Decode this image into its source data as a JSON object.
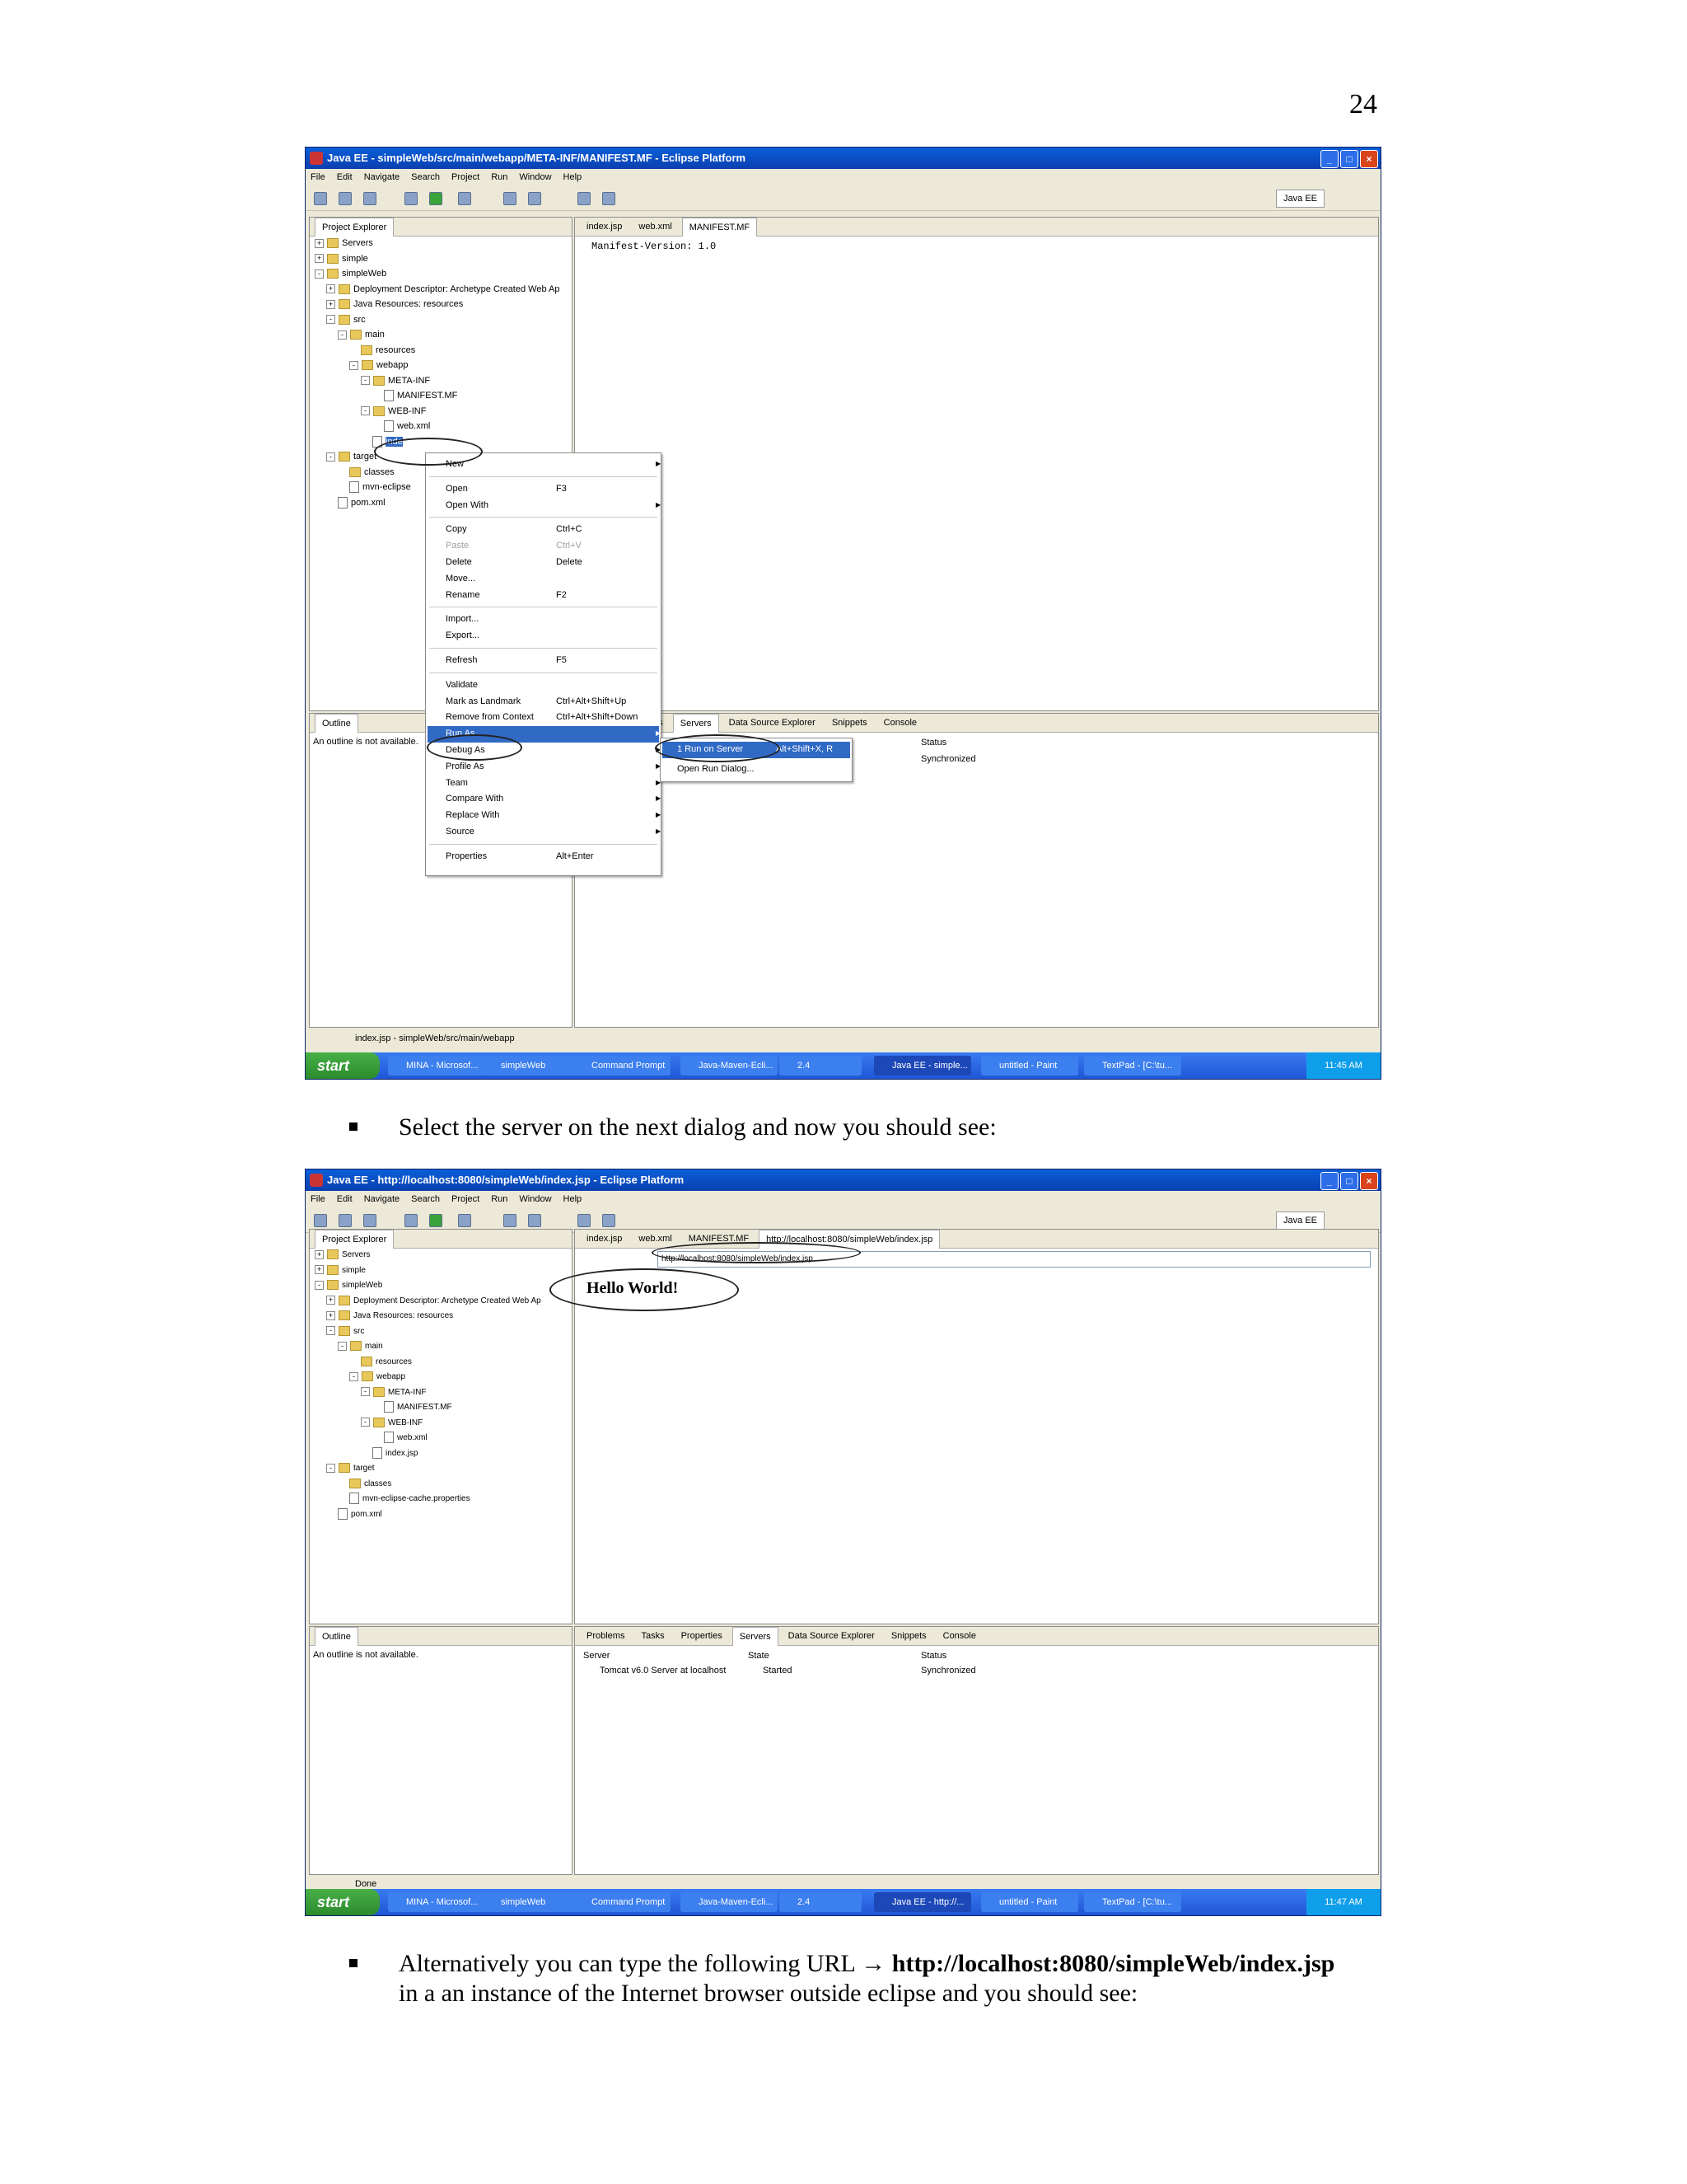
{
  "page_number": "24",
  "bullet1": "Select the server on the next dialog and now you should see:",
  "bullet2": {
    "prefix": "Alternatively you can type the following URL → ",
    "url": "http://localhost:8080/simpleWeb/index.jsp",
    "suffix": "in a an instance of the Internet browser outside eclipse and you should see:"
  },
  "shot1": {
    "title": "Java EE - simpleWeb/src/main/webapp/META-INF/MANIFEST.MF - Eclipse Platform",
    "menus": [
      "File",
      "Edit",
      "Navigate",
      "Search",
      "Project",
      "Run",
      "Window",
      "Help"
    ],
    "perspective": "Java EE",
    "explorer_title": "Project Explorer",
    "tree": [
      {
        "label": "Servers",
        "depth": 0,
        "exp": "+"
      },
      {
        "label": "simple",
        "depth": 0,
        "exp": "+"
      },
      {
        "label": "simpleWeb",
        "depth": 0,
        "exp": "-"
      },
      {
        "label": "Deployment Descriptor: Archetype Created Web Ap",
        "depth": 1,
        "exp": "+"
      },
      {
        "label": "Java Resources: resources",
        "depth": 1,
        "exp": "+"
      },
      {
        "label": "src",
        "depth": 1,
        "exp": "-"
      },
      {
        "label": "main",
        "depth": 2,
        "exp": "-"
      },
      {
        "label": "resources",
        "depth": 3,
        "exp": ""
      },
      {
        "label": "webapp",
        "depth": 3,
        "exp": "-"
      },
      {
        "label": "META-INF",
        "depth": 4,
        "exp": "-"
      },
      {
        "label": "MANIFEST.MF",
        "depth": 5,
        "exp": "",
        "file": true
      },
      {
        "label": "WEB-INF",
        "depth": 4,
        "exp": "-"
      },
      {
        "label": "web.xml",
        "depth": 5,
        "exp": "",
        "file": true
      },
      {
        "label": "inde",
        "depth": 4,
        "exp": "",
        "file": true
      },
      {
        "label": "target",
        "depth": 1,
        "exp": "-"
      },
      {
        "label": "classes",
        "depth": 2,
        "exp": ""
      },
      {
        "label": "mvn-eclipse",
        "depth": 2,
        "exp": "",
        "file": true
      },
      {
        "label": "pom.xml",
        "depth": 1,
        "exp": "",
        "file": true
      }
    ],
    "editor_tabs": [
      "index.jsp",
      "web.xml",
      "MANIFEST.MF"
    ],
    "editor_content": "Manifest-Version: 1.0",
    "outline_title": "Outline",
    "outline_msg": "An outline is not available.",
    "bottom_tabs": [
      "asks",
      "Properties",
      "Servers",
      "Data Source Explorer",
      "Snippets",
      "Console"
    ],
    "servers_status_head": "Status",
    "servers_status_val": "Synchronized",
    "context_menu": [
      {
        "label": "New",
        "shortcut": "",
        "sub": true
      },
      {
        "sep": true
      },
      {
        "label": "Open",
        "shortcut": "F3"
      },
      {
        "label": "Open With",
        "shortcut": "",
        "sub": true
      },
      {
        "sep": true
      },
      {
        "label": "Copy",
        "shortcut": "Ctrl+C"
      },
      {
        "label": "Paste",
        "shortcut": "Ctrl+V",
        "disabled": true
      },
      {
        "label": "Delete",
        "shortcut": "Delete"
      },
      {
        "label": "Move...",
        "shortcut": ""
      },
      {
        "label": "Rename",
        "shortcut": "F2"
      },
      {
        "sep": true
      },
      {
        "label": "Import...",
        "shortcut": ""
      },
      {
        "label": "Export...",
        "shortcut": ""
      },
      {
        "sep": true
      },
      {
        "label": "Refresh",
        "shortcut": "F5"
      },
      {
        "sep": true
      },
      {
        "label": "Validate",
        "shortcut": ""
      },
      {
        "label": "Mark as Landmark",
        "shortcut": "Ctrl+Alt+Shift+Up"
      },
      {
        "label": "Remove from Context",
        "shortcut": "Ctrl+Alt+Shift+Down"
      },
      {
        "label": "Run As",
        "shortcut": "",
        "sub": true,
        "highlight": true
      },
      {
        "label": "Debug As",
        "shortcut": "",
        "sub": true
      },
      {
        "label": "Profile As",
        "shortcut": "",
        "sub": true
      },
      {
        "label": "Team",
        "shortcut": "",
        "sub": true
      },
      {
        "label": "Compare With",
        "shortcut": "",
        "sub": true
      },
      {
        "label": "Replace With",
        "shortcut": "",
        "sub": true
      },
      {
        "label": "Source",
        "shortcut": "",
        "sub": true
      },
      {
        "sep": true
      },
      {
        "label": "Properties",
        "shortcut": "Alt+Enter"
      }
    ],
    "submenu": [
      {
        "label": "1 Run on Server",
        "shortcut": "Alt+Shift+X, R"
      },
      {
        "label": "Open Run Dialog...",
        "shortcut": ""
      }
    ],
    "status": "index.jsp - simpleWeb/src/main/webapp",
    "taskbar": {
      "start": "start",
      "tasks": [
        "MINA - Microsof...",
        "simpleWeb",
        "Command Prompt",
        "Java-Maven-Ecli...",
        "2.4",
        "Java EE - simple...",
        "untitled - Paint",
        "TextPad - [C:\\tu..."
      ],
      "time": "11:45 AM"
    }
  },
  "shot2": {
    "title": "Java EE - http://localhost:8080/simpleWeb/index.jsp - Eclipse Platform",
    "menus": [
      "File",
      "Edit",
      "Navigate",
      "Search",
      "Project",
      "Run",
      "Window",
      "Help"
    ],
    "perspective": "Java EE",
    "explorer_title": "Project Explorer",
    "tree": [
      {
        "label": "Servers",
        "depth": 0,
        "exp": "+"
      },
      {
        "label": "simple",
        "depth": 0,
        "exp": "+"
      },
      {
        "label": "simpleWeb",
        "depth": 0,
        "exp": "-"
      },
      {
        "label": "Deployment Descriptor: Archetype Created Web Ap",
        "depth": 1,
        "exp": "+"
      },
      {
        "label": "Java Resources: resources",
        "depth": 1,
        "exp": "+"
      },
      {
        "label": "src",
        "depth": 1,
        "exp": "-"
      },
      {
        "label": "main",
        "depth": 2,
        "exp": "-"
      },
      {
        "label": "resources",
        "depth": 3,
        "exp": ""
      },
      {
        "label": "webapp",
        "depth": 3,
        "exp": "-"
      },
      {
        "label": "META-INF",
        "depth": 4,
        "exp": "-"
      },
      {
        "label": "MANIFEST.MF",
        "depth": 5,
        "exp": "",
        "file": true
      },
      {
        "label": "WEB-INF",
        "depth": 4,
        "exp": "-"
      },
      {
        "label": "web.xml",
        "depth": 5,
        "exp": "",
        "file": true
      },
      {
        "label": "index.jsp",
        "depth": 4,
        "exp": "",
        "file": true
      },
      {
        "label": "target",
        "depth": 1,
        "exp": "-"
      },
      {
        "label": "classes",
        "depth": 2,
        "exp": ""
      },
      {
        "label": "mvn-eclipse-cache.properties",
        "depth": 2,
        "exp": "",
        "file": true
      },
      {
        "label": "pom.xml",
        "depth": 1,
        "exp": "",
        "file": true
      }
    ],
    "editor_tabs": [
      "index.jsp",
      "web.xml",
      "MANIFEST.MF",
      "http://localhost:8080/simpleWeb/index.jsp"
    ],
    "url": "http://localhost:8080/simpleWeb/index.jsp",
    "hello": "Hello World!",
    "outline_title": "Outline",
    "outline_msg": "An outline is not available.",
    "bottom_tabs": [
      "Problems",
      "Tasks",
      "Properties",
      "Servers",
      "Data Source Explorer",
      "Snippets",
      "Console"
    ],
    "servers_cols": [
      "Server",
      "State",
      "Status"
    ],
    "servers_row": [
      "Tomcat v6.0 Server at localhost",
      "Started",
      "Synchronized"
    ],
    "status": "Done",
    "taskbar": {
      "start": "start",
      "tasks": [
        "MINA - Microsof...",
        "simpleWeb",
        "Command Prompt",
        "Java-Maven-Ecli...",
        "2.4",
        "Java EE - http://...",
        "untitled - Paint",
        "TextPad - [C:\\tu..."
      ],
      "time": "11:47 AM"
    }
  }
}
